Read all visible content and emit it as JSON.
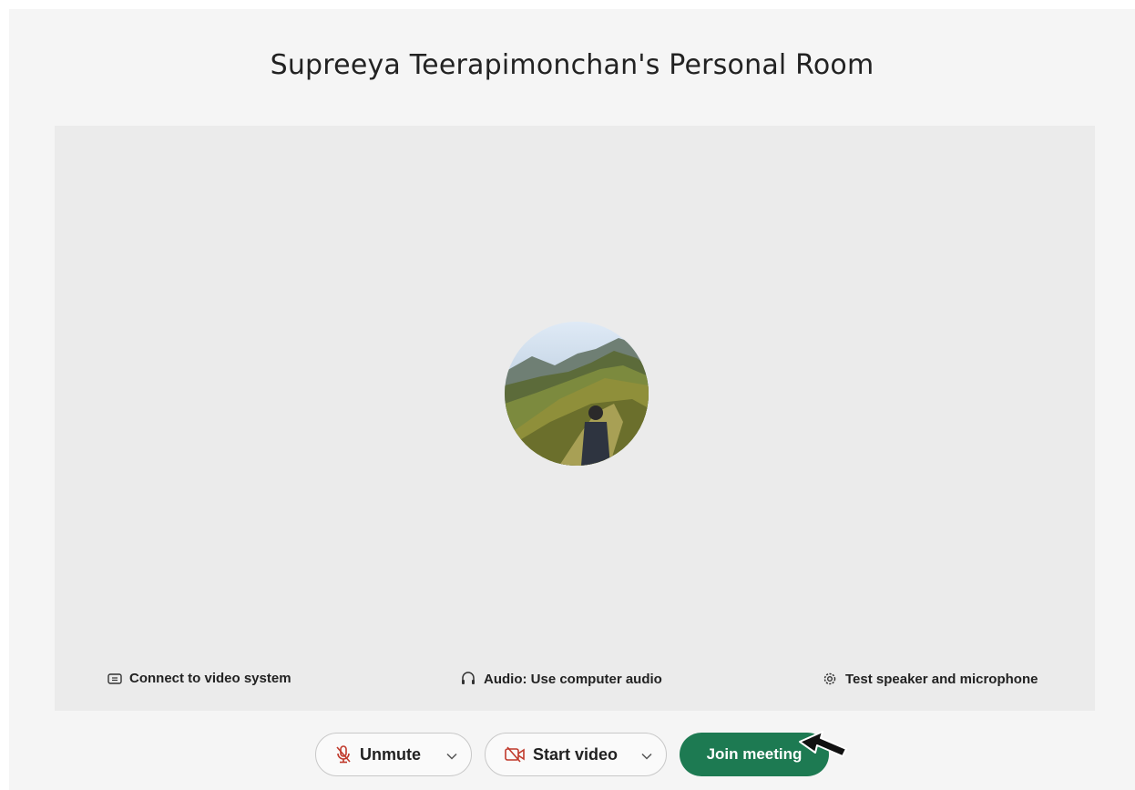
{
  "room": {
    "title": "Supreeya Teerapimonchan's Personal Room"
  },
  "preview": {
    "avatar_icon": "profile-photo"
  },
  "options": {
    "connect_video_label": "Connect to video system",
    "audio_label": "Audio: Use computer audio",
    "test_label": "Test speaker and microphone"
  },
  "controls": {
    "unmute_label": "Unmute",
    "start_video_label": "Start video",
    "join_label": "Join meeting"
  },
  "colors": {
    "join_button": "#1d7a52",
    "muted_icon": "#c0392b"
  }
}
